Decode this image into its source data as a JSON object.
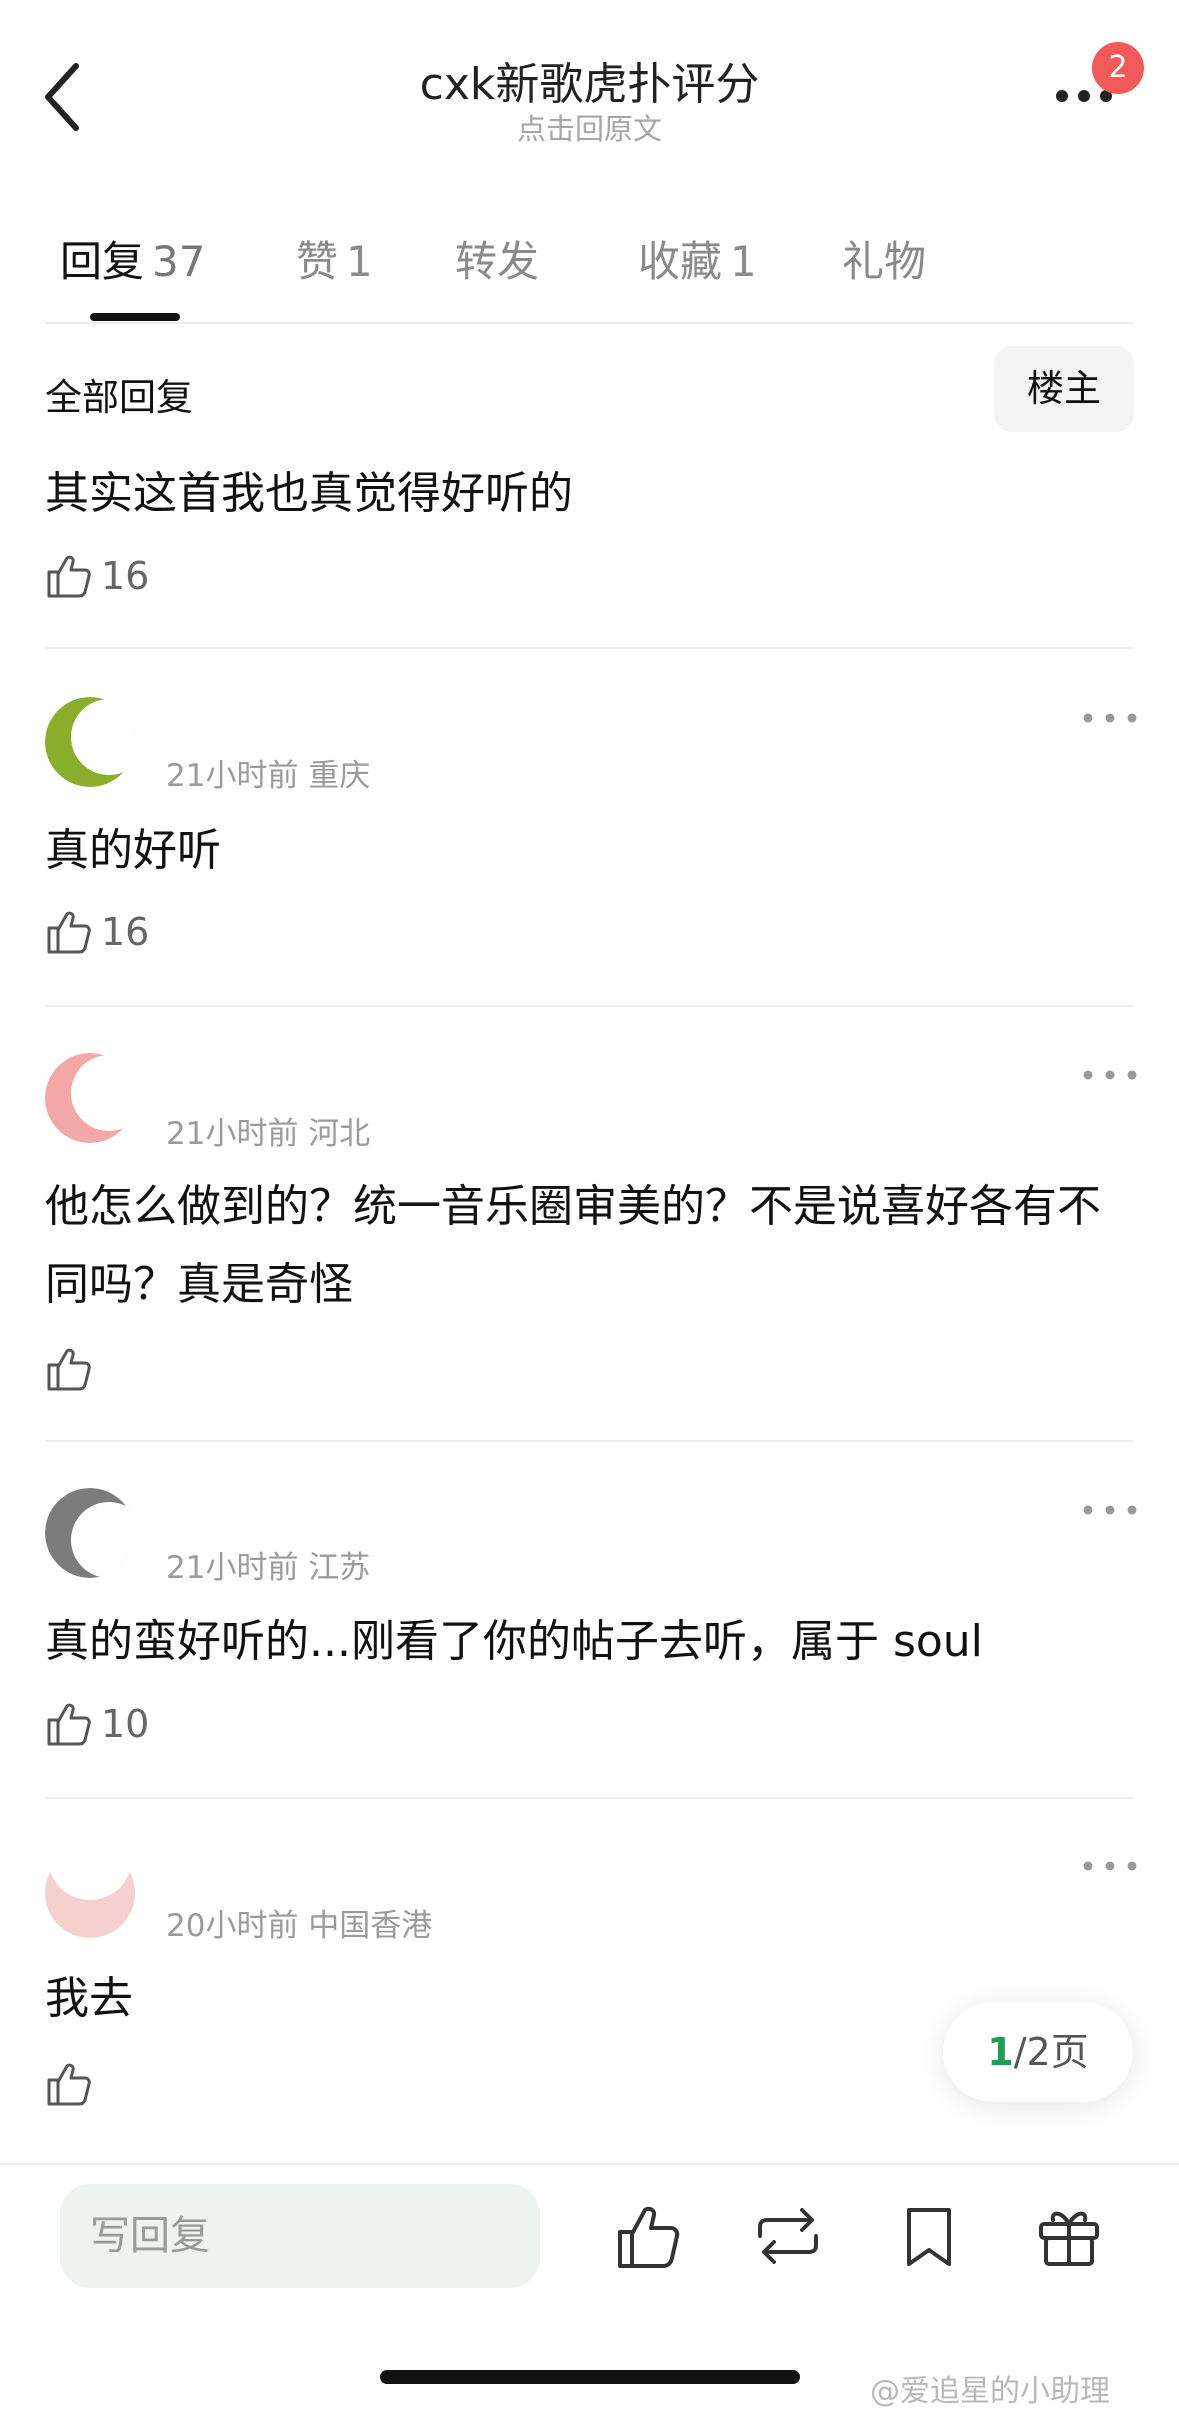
{
  "header": {
    "title": "cxk新歌虎扑评分",
    "subtitle": "点击回原文",
    "badge_count": "2",
    "icons": [
      "back-icon",
      "more-icon"
    ]
  },
  "tabs": [
    {
      "label": "回复",
      "count": "37",
      "active": true
    },
    {
      "label": "赞",
      "count": "1"
    },
    {
      "label": "转发",
      "count": ""
    },
    {
      "label": "收藏",
      "count": "1"
    },
    {
      "label": "礼物",
      "count": ""
    }
  ],
  "filter": {
    "all_replies": "全部回复",
    "owner_only": "楼主"
  },
  "replies": [
    {
      "text": "其实这首我也真觉得好听的",
      "likes": "16"
    },
    {
      "time_location": "21小时前 重庆",
      "text": "真的好听",
      "likes": "16"
    },
    {
      "time_location": "21小时前 河北",
      "text": "他怎么做到的？统一音乐圈审美的？不是说喜好各有不同吗？真是奇怪",
      "likes": ""
    },
    {
      "time_location": "21小时前 江苏",
      "text": "真的蛮好听的...刚看了你的帖子去听，属于 soul",
      "likes": "10"
    },
    {
      "time_location": "20小时前 中国香港",
      "text": "我去",
      "likes": ""
    }
  ],
  "pagination": {
    "current": "1",
    "total": "/2页"
  },
  "bottom_bar": {
    "input_placeholder": "写回复",
    "icons": [
      "like-icon",
      "repost-icon",
      "bookmark-icon",
      "gift-icon"
    ]
  },
  "watermark": "@爱追星的小助理",
  "colors": {
    "badge": "#f25a5a",
    "page_current": "#1f9d55",
    "input_bg": "#eef3ef"
  }
}
